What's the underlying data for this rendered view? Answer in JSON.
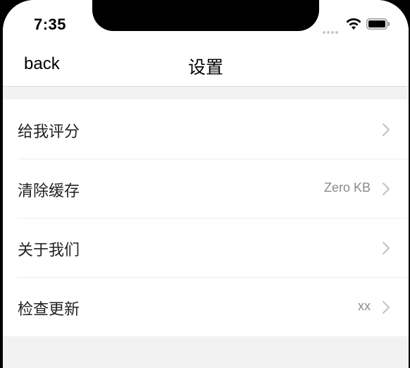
{
  "status_bar": {
    "time": "7:35",
    "icons": [
      "signal-dots-icon",
      "wifi-icon",
      "battery-icon"
    ]
  },
  "nav": {
    "back_label": "back",
    "title": "设置"
  },
  "settings": {
    "items": [
      {
        "label": "给我评分",
        "value": "",
        "icon": "chevron-right-icon"
      },
      {
        "label": "清除缓存",
        "value": "Zero KB",
        "icon": "chevron-right-icon"
      },
      {
        "label": "关于我们",
        "value": "",
        "icon": "chevron-right-icon"
      },
      {
        "label": "检查更新",
        "value": "xx",
        "icon": "chevron-right-icon"
      }
    ]
  },
  "colors": {
    "background": "#f2f2f2",
    "surface": "#ffffff",
    "secondary_text": "#8a8a8a",
    "chevron": "#c4c4c4"
  }
}
